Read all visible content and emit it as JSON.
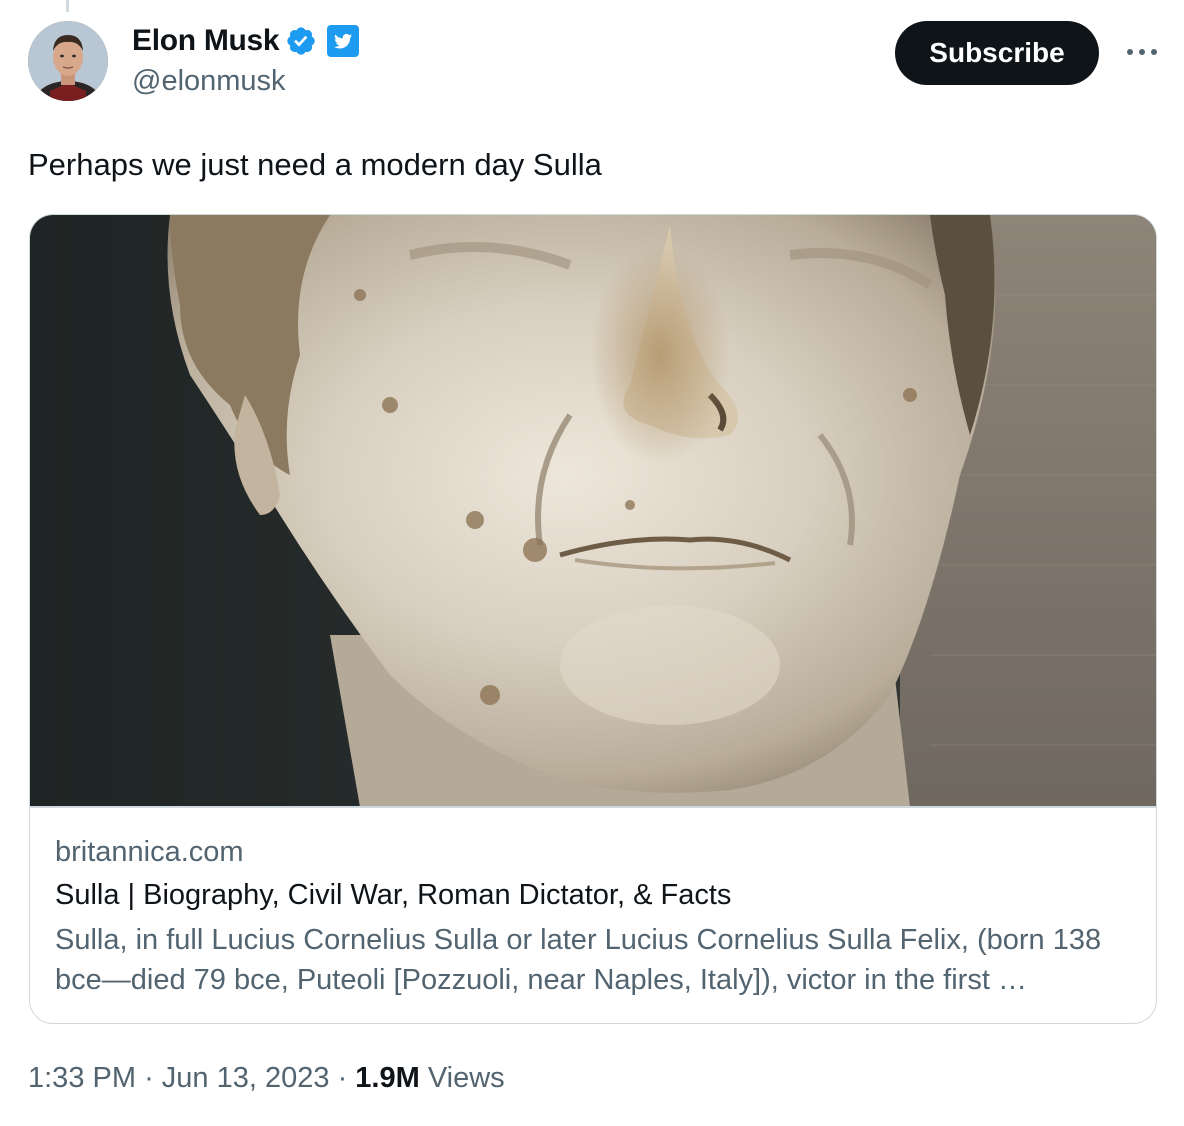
{
  "author": {
    "display_name": "Elon Musk",
    "handle": "@elonmusk",
    "avatar_icon": "profile-photo",
    "verified_icon": "verified-badge-icon",
    "affiliate_icon": "twitter-bird-icon"
  },
  "actions": {
    "subscribe_label": "Subscribe",
    "more_icon": "more-horizontal-icon"
  },
  "tweet": {
    "text": "Perhaps we just need a modern day Sulla"
  },
  "link_card": {
    "image_icon": "marble-bust-image",
    "domain": "britannica.com",
    "title": "Sulla | Biography, Civil War, Roman Dictator, & Facts",
    "description": "Sulla, in full Lucius Cornelius Sulla or later Lucius Cornelius Sulla Felix, (born 138 bce—died 79 bce, Puteoli [Pozzuoli, near Naples, Italy]), victor in the first …"
  },
  "meta": {
    "time": "1:33 PM",
    "separator": "·",
    "date": "Jun 13, 2023",
    "views_count": "1.9M",
    "views_label": "Views"
  },
  "colors": {
    "text_primary": "#0f1419",
    "text_secondary": "#536471",
    "border": "#cfd9de",
    "verified_blue": "#1d9bf0"
  }
}
